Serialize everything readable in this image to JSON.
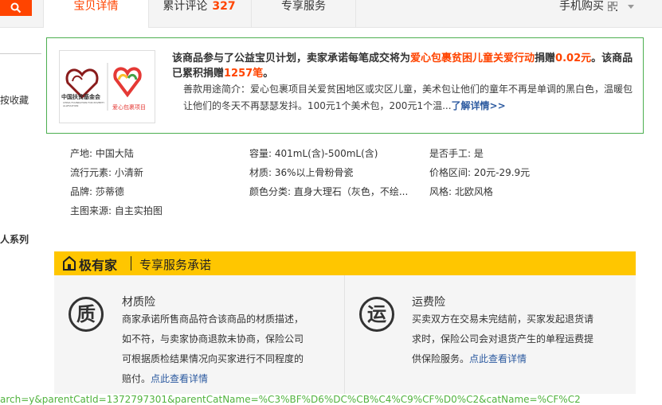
{
  "tabs": {
    "details": "宝贝详情",
    "reviews": "累计评论",
    "review_count": "327",
    "service": "专享服务",
    "mobile_buy": "手机购买"
  },
  "sidebar": {
    "favorite": "按收藏",
    "series": "人系列"
  },
  "charity": {
    "title_prefix": "该商品参与了公益宝贝计划，卖家承诺每笔成交将为",
    "project": "爱心包裹贫困儿童关爱行动",
    "donate_word": "捐赠",
    "amount": "0.02元",
    "middle": "。该商品已累积捐赠",
    "count": "1257笔",
    "end": "。",
    "desc_label": "善款用途简介：",
    "desc": "爱心包裹项目关爱贫困地区或灾区儿童，美术包让他们的童年不再是单调的黑白色，温暖包让他们的冬天不再瑟瑟发抖。100元1个美术包，200元1个温...",
    "more_link": "了解详情>>",
    "logo_text_left": "中国扶贫基金会",
    "logo_text_left_en": "CHINA FOUNDATION FOR POVERTY ALLEVIATION",
    "logo_text_right": "爱心包裹项目"
  },
  "attributes": [
    "产地: 中国大陆",
    "容量: 401mL(含)-500mL(含)",
    "是否手工: 是",
    "流行元素: 小清新",
    "材质: 36%以上骨粉骨瓷",
    "价格区间: 20元-29.9元",
    "品牌: 莎蒂德",
    "颜色分类: 直身大理石（灰色，不绘...",
    "风格: 北欧风格",
    "主图来源: 自主实拍图"
  ],
  "service": {
    "brand": "极有家",
    "title": "专享服务承诺",
    "left": {
      "icon": "质",
      "name": "材质险",
      "lines": [
        "商家承诺所售商品符合该商品的材质描述，",
        "如不符，与卖家协商退款未协商，保险公司",
        "可根据质检结果情况向买家进行不同程度的"
      ],
      "last": "赔付。",
      "link": "点此查看详情"
    },
    "right": {
      "icon": "运",
      "name": "运费险",
      "lines": [
        "买卖双方在交易未完结前，买家发起退货请",
        "求时，保险公司会对退货产生的单程运费提"
      ],
      "last": "供保险服务。",
      "link": "点此查看详情"
    }
  },
  "status_url": "arch=y&parentCatId=1372797301&parentCatName=%C3%BF%D6%DC%CB%C4%C9%CF%D0%C2&catName=%CF%C2"
}
